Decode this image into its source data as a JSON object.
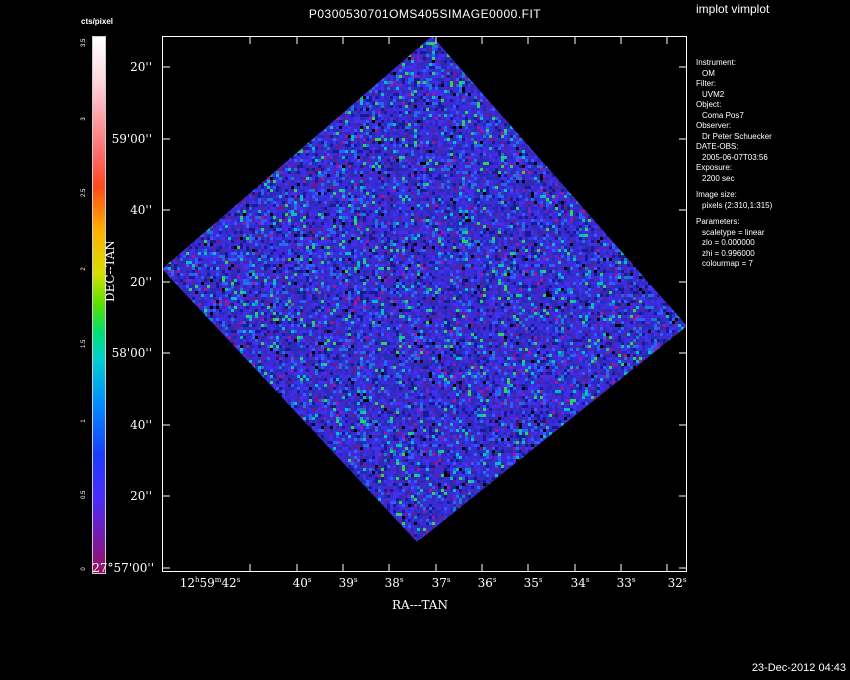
{
  "window": {
    "app_title": "implot vimplot",
    "image_title": "P0300530701OMS405SIMAGE0000.FIT",
    "timestamp": "23-Dec-2012 04:43"
  },
  "colorbar": {
    "label": "cts/pixel",
    "ticks": [
      "3.5",
      "3",
      "2.5",
      "2",
      "1.5",
      "1",
      "0.5",
      "0"
    ],
    "tick_values": [
      3.5,
      3,
      2.5,
      2,
      1.5,
      1,
      0.5,
      0
    ],
    "range": [
      0,
      3.6
    ]
  },
  "axes": {
    "x_title": "RA---TAN",
    "y_title": "DEC--TAN",
    "x_ticks": [
      {
        "main": "12",
        "h": "h",
        "mid": "59",
        "m": "m",
        "end": "42",
        "s": "s"
      },
      {
        "main": "40",
        "s": "s"
      },
      {
        "main": "39",
        "s": "s"
      },
      {
        "main": "38",
        "s": "s"
      },
      {
        "main": "37",
        "s": "s"
      },
      {
        "main": "36",
        "s": "s"
      },
      {
        "main": "35",
        "s": "s"
      },
      {
        "main": "34",
        "s": "s"
      },
      {
        "main": "33",
        "s": "s"
      },
      {
        "main": "32",
        "s": "s"
      }
    ],
    "y_ticks": [
      "20''",
      "59'00''",
      "40''",
      "20''",
      "58'00''",
      "40''",
      "20''",
      "27°57'00''"
    ]
  },
  "info": {
    "instrument_label": "Instrument:",
    "instrument": "OM",
    "filter_label": "Filter:",
    "filter": "UVM2",
    "object_label": "Object:",
    "object": "Coma Pos7",
    "observer_label": "Observer:",
    "observer": "Dr Peter Schuecker",
    "date_label": "DATE-OBS:",
    "date": "2005-06-07T03:56",
    "exposure_label": "Exposure:",
    "exposure": "2200 sec",
    "imagesize_label": "Image size:",
    "imagesize": "pixels (2:310,1:315)",
    "params_label": "Parameters:",
    "scaletype": "scaletype = linear",
    "zlo": "zlo = 0.000000",
    "zhi": "zhi = 0.996000",
    "colourmap": "colourmap =   7"
  },
  "image": {
    "noise_colors": [
      "#3a2ad8",
      "#2a2ab8",
      "#4030f0",
      "#1a1a90",
      "#5a20a0",
      "#1a7ad0",
      "#00c0c0",
      "#30d060",
      "#9a1aa0",
      "#000000",
      "#2a60ff"
    ]
  }
}
